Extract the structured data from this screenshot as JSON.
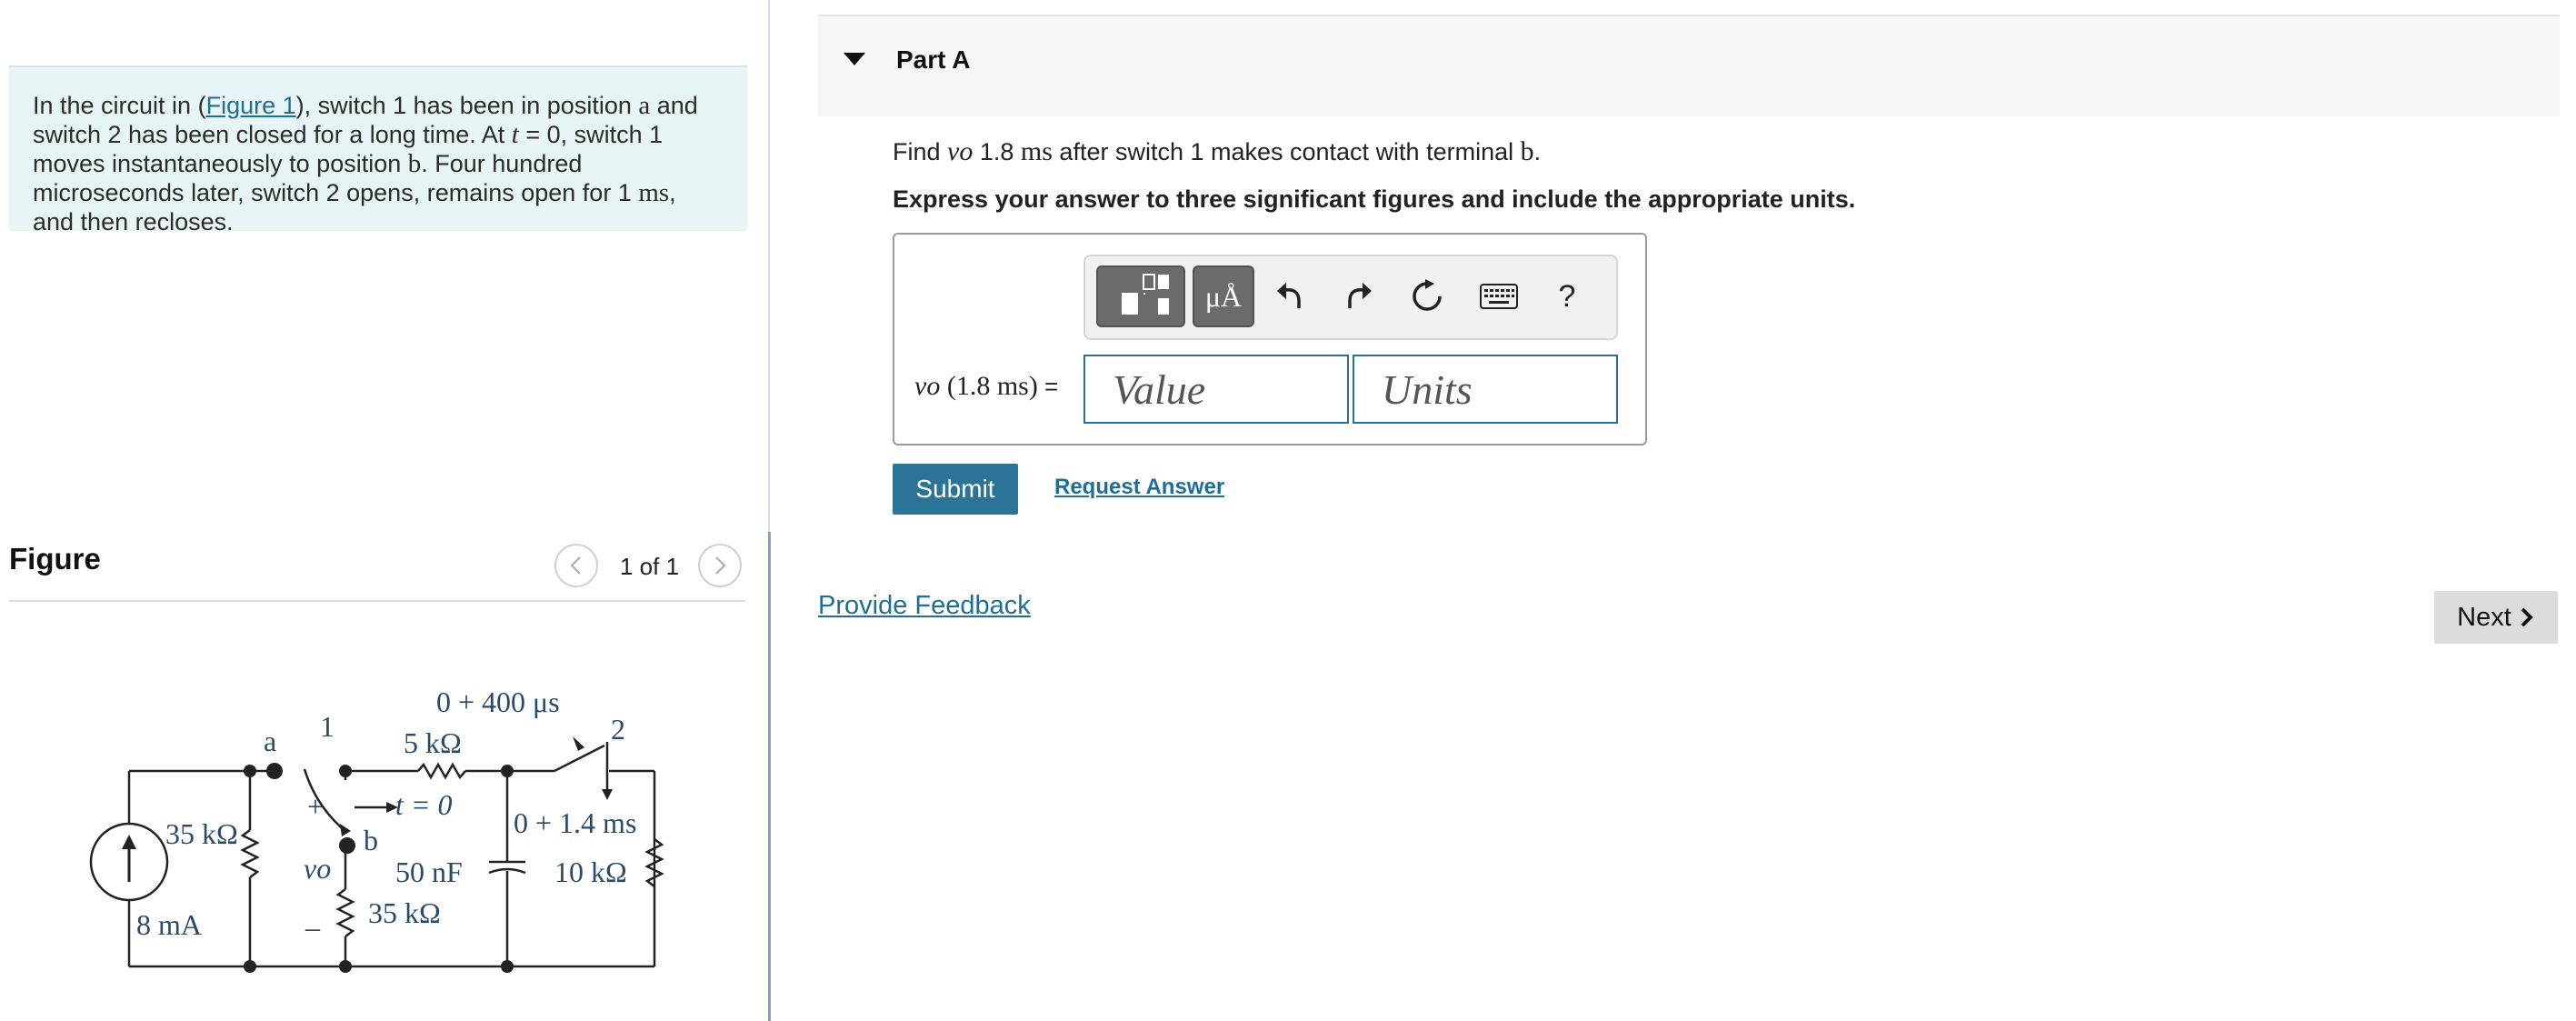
{
  "problem": {
    "text_1": "In the circuit in (",
    "figure_link": "Figure 1",
    "text_2": "), switch 1 has been in position ",
    "pos_a": "a",
    "text_3": " and switch 2 has been closed for a long time. At ",
    "t_var": "t",
    "text_4": " = 0, switch 1 moves instantaneously to position ",
    "pos_b": "b",
    "text_5": ". Four hundred microseconds later, switch 2 opens, remains open for 1 ",
    "ms_unit": "ms",
    "text_6": ", and then recloses."
  },
  "figure": {
    "title": "Figure",
    "pager": "1 of 1"
  },
  "circuit": {
    "node_a": "a",
    "switch1_label": "1",
    "switch2_label": "2",
    "switch2_timing": "0 + 400 μs",
    "r_series": "5 kΩ",
    "switch1_time": "t = 0",
    "node_b": "b",
    "switch2_open": "0 + 1.4 ms",
    "r_left": "35 kΩ",
    "r_mid": "35 kΩ",
    "cap": "50 nF",
    "r_right": "10 kΩ",
    "source": "8 mA",
    "plus": "+",
    "minus": "_",
    "vo": "vo"
  },
  "part": {
    "title": "Part A"
  },
  "question": {
    "text_1": "Find ",
    "var": "vo",
    "value": " 1.8 ",
    "unit": "ms",
    "text_2": " after switch 1 makes contact with terminal ",
    "terminal": "b",
    "text_3": "."
  },
  "instruction": "Express your answer to three significant figures and include the appropriate units.",
  "toolbar": {
    "units_symbol": "μÅ",
    "help_symbol": "?"
  },
  "answer": {
    "label_var": "vo",
    "label_arg": " (1.8 ms)",
    "label_eq": " =",
    "value_placeholder": "Value",
    "units_placeholder": "Units"
  },
  "actions": {
    "submit": "Submit",
    "request": "Request Answer",
    "feedback": "Provide Feedback",
    "next": "Next"
  },
  "colors": {
    "accent": "#2c7398",
    "link": "#1f6f94",
    "problem_bg": "#e8f5f7",
    "circuit_text": "#2a4a6a"
  }
}
